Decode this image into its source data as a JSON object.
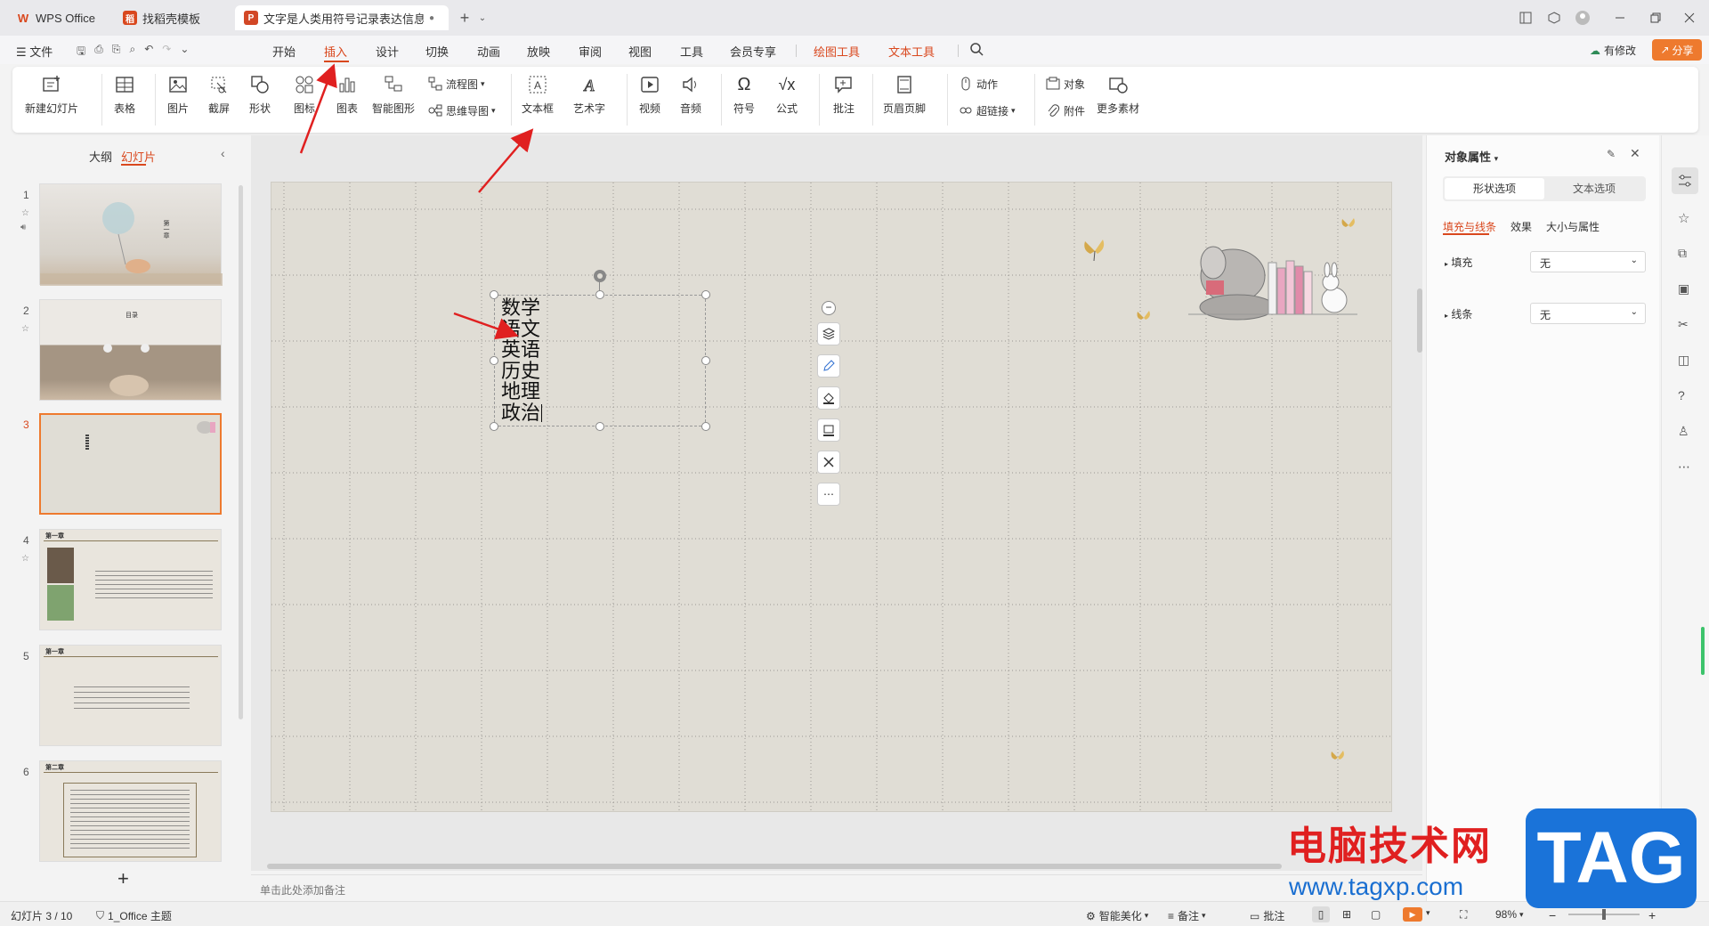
{
  "titlebar": {
    "tabs": [
      {
        "label": "WPS Office",
        "icon": "wps-logo"
      },
      {
        "label": "找稻壳模板",
        "icon": "docer-logo"
      },
      {
        "label": "文字是人类用符号记录表达信息以",
        "icon": "ppt-file-icon"
      }
    ],
    "new_tab": "+",
    "colors": {
      "accent": "#d9481e",
      "ppt": "#d24726"
    }
  },
  "menubar": {
    "file": "文件",
    "items": [
      "开始",
      "插入",
      "设计",
      "切换",
      "动画",
      "放映",
      "审阅",
      "视图",
      "工具",
      "会员专享"
    ],
    "contextual": [
      "绘图工具",
      "文本工具"
    ],
    "active": "插入",
    "has_changes": "有修改",
    "share": "分享"
  },
  "ribbon": {
    "new_slide": "新建幻灯片",
    "table": "表格",
    "picture": "图片",
    "screenshot": "截屏",
    "shape": "形状",
    "icon": "图标",
    "chart": "图表",
    "smart_art": "智能图形",
    "flowchart": "流程图",
    "mindmap": "思维导图",
    "textbox": "文本框",
    "wordart": "艺术字",
    "video": "视频",
    "audio": "音频",
    "symbol": "符号",
    "formula": "公式",
    "comment": "批注",
    "header_footer": "页眉页脚",
    "action": "动作",
    "hyperlink": "超链接",
    "object": "对象",
    "attachment": "附件",
    "more_material": "更多素材"
  },
  "leftpanel": {
    "tab_outline": "大纲",
    "tab_slides": "幻灯片",
    "slides": [
      "1",
      "2",
      "3",
      "4",
      "5",
      "6"
    ],
    "selected": "3",
    "thumb_titles": {
      "s1": "第一章",
      "s2": "目录",
      "s4": "第一章",
      "s5": "第一章",
      "s6": "第二章"
    },
    "add": "+"
  },
  "slide": {
    "lines": [
      "数学",
      "语文",
      "英语",
      "历史",
      "地理",
      "政治"
    ]
  },
  "notes": {
    "placeholder": "单击此处添加备注"
  },
  "rightpanel": {
    "title": "对象属性",
    "tabs": [
      "形状选项",
      "文本选项"
    ],
    "subtabs": [
      "填充与线条",
      "效果",
      "大小与属性"
    ],
    "fill_label": "填充",
    "fill_value": "无",
    "line_label": "线条",
    "line_value": "无"
  },
  "statusbar": {
    "slide_count": "幻灯片 3 / 10",
    "theme": "1_Office 主题",
    "beautify": "智能美化",
    "notes": "备注",
    "comments": "批注",
    "zoom": "98%"
  },
  "watermark": {
    "text": "电脑技术网",
    "url": "www.tagxp.com",
    "logo": "TAG"
  }
}
